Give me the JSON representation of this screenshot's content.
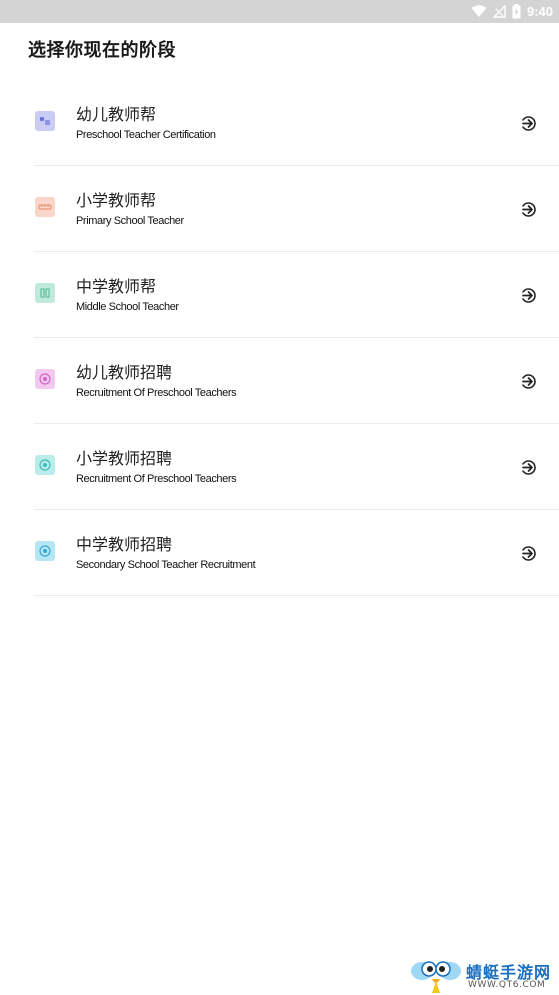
{
  "status_bar": {
    "time": "9:40"
  },
  "page": {
    "title": "选择你现在的阶段"
  },
  "items": [
    {
      "title": "幼儿教师帮",
      "subtitle": "Preschool Teacher Certification",
      "icon": "blocks-icon",
      "color": "#c9cdf4",
      "glyph_color": "#6b72d8"
    },
    {
      "title": "小学教师帮",
      "subtitle": "Primary School Teacher",
      "icon": "ruler-icon",
      "color": "#f9d6c9",
      "glyph_color": "#e58a6a"
    },
    {
      "title": "中学教师帮",
      "subtitle": "Middle School Teacher",
      "icon": "book-icon",
      "color": "#bfe9d9",
      "glyph_color": "#4fb890"
    },
    {
      "title": "幼儿教师招聘",
      "subtitle": "Recruitment Of Preschool Teachers",
      "icon": "badge-icon",
      "color": "#f2c8ee",
      "glyph_color": "#d166c7"
    },
    {
      "title": "小学教师招聘",
      "subtitle": "Recruitment Of Preschool Teachers",
      "icon": "badge-icon",
      "color": "#b9ecea",
      "glyph_color": "#3fbdb6"
    },
    {
      "title": "中学教师招聘",
      "subtitle": "Secondary School Teacher Recruitment",
      "icon": "badge-icon",
      "color": "#b6e6f4",
      "glyph_color": "#36a9cf"
    }
  ],
  "watermark": {
    "name": "蜻蜓手游网",
    "url": "WWW.QT6.COM"
  }
}
